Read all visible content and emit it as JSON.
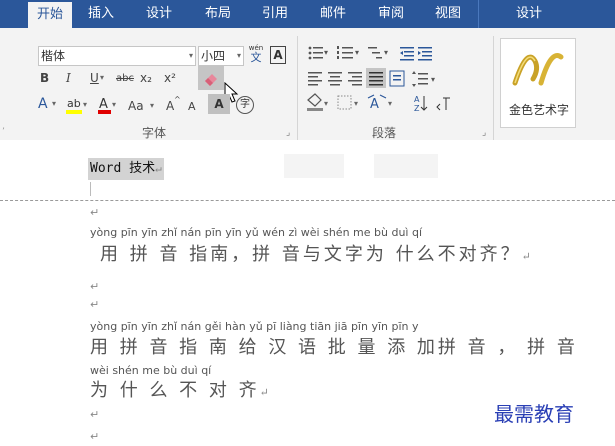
{
  "tabs": [
    "开始",
    "插入",
    "设计",
    "布局",
    "引用",
    "邮件",
    "审阅",
    "视图",
    "设计"
  ],
  "font": {
    "name": "楷体",
    "size": "小四",
    "phonetic_top": "wén",
    "phonetic_bottom": "文",
    "border_char": "A",
    "bold": "B",
    "italic": "I",
    "underline": "U",
    "strike": "abc",
    "sub": "x₂",
    "sup": "x²",
    "case": "Aa",
    "grow": "A",
    "shrink": "A",
    "shade_char": "A",
    "enclosed": "字"
  },
  "group_labels": {
    "font": "字体",
    "paragraph": "段落"
  },
  "style_label": "金色艺术字",
  "doc": {
    "heading": "Word 技术",
    "para_marks": [
      "↵",
      "↵",
      "↵",
      "↵",
      "↵",
      "↵",
      "↵"
    ],
    "para1_pinyin": "yòng pīn yīn zhǐ nán   pīn yīn yǔ wén  zì wèi shén me bù duì qí",
    "para1_text": "用 拼 音 指南，拼 音与文字为 什么不对齐？",
    "para2_pinyin": "yòng pīn yīn zhǐ nán gěi hàn  yǔ  pī liàng tiān jiā pīn yīn        pīn y",
    "para2_text": "用 拼 音 指 南 给 汉 语 批 量 添 加拼 音 ，  拼 音",
    "para3_pinyin": "wèi shén me  bù  duì  qí",
    "para3_text": "为 什 么 不 对 齐"
  },
  "watermark": "最需教育"
}
